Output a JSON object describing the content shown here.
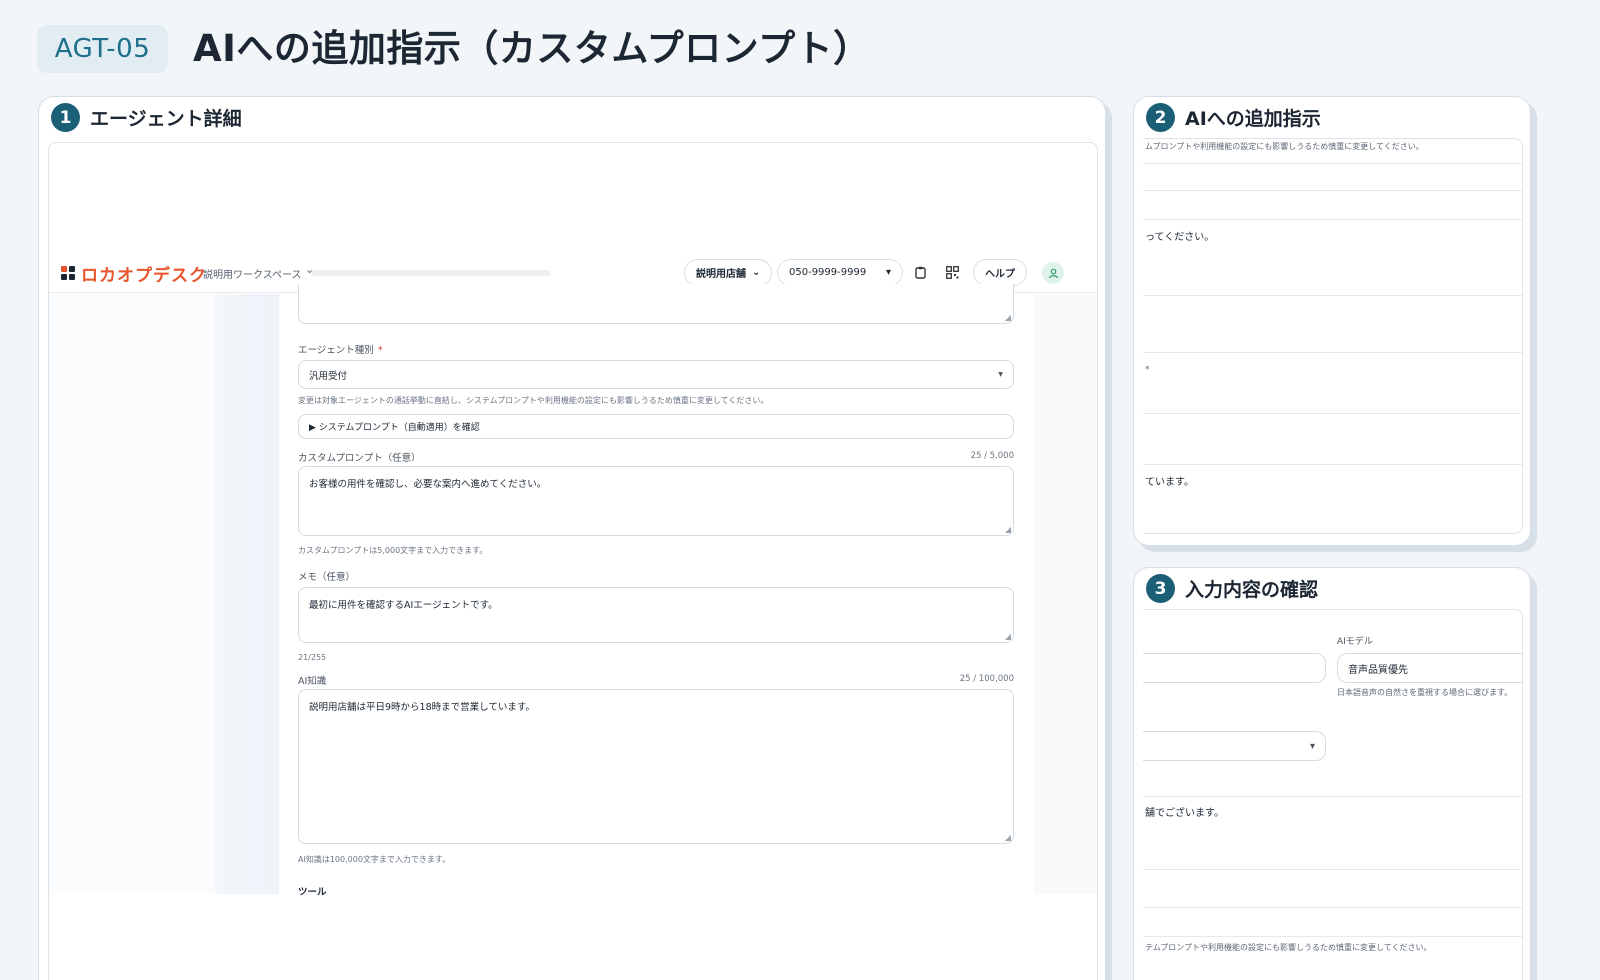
{
  "header": {
    "code": "AGT-05",
    "title": "AIへの追加指示（カスタムプロンプト）"
  },
  "panels": [
    {
      "number": "1",
      "title": "エージェント詳細"
    },
    {
      "number": "2",
      "title": "AIへの追加指示"
    },
    {
      "number": "3",
      "title": "入力内容の確認"
    }
  ],
  "app": {
    "logo_text": "ロカオプデスク",
    "workspace": "説明用ワークスペース",
    "store_select": "説明用店舗",
    "phone_select": "050-9999-9999",
    "help_label": "ヘルプ"
  },
  "form": {
    "agent_type_label": "エージェント種別",
    "required_mark": "*",
    "agent_type_value": "汎用受付",
    "agent_type_hint": "変更は対象エージェントの通話挙動に直結し、システムプロンプトや利用機能の設定にも影響しうるため慎重に変更してください。",
    "system_prompt_toggle": "▶ システムプロンプト（自動適用）を確認",
    "custom_prompt_label": "カスタムプロンプト（任意）",
    "custom_prompt_count": "25 / 5,000",
    "custom_prompt_value": "お客様の用件を確認し、必要な案内へ進めてください。",
    "custom_prompt_hint": "カスタムプロンプトは5,000文字まで入力できます。",
    "memo_label": "メモ（任意）",
    "memo_value": "最初に用件を確認するAIエージェントです。",
    "memo_count": "21/255",
    "knowledge_label": "AI知識",
    "knowledge_count": "25 / 100,000",
    "knowledge_value": "説明用店舗は平日9時から18時まで営業しています。",
    "knowledge_hint": "AI知識は100,000文字まで入力できます。",
    "tools_label": "ツール"
  },
  "panel2": {
    "hint_fragment": "ムプロンプトや利用機能の設定にも影響しうるため慎重に変更してください。",
    "prompt_fragment": "ってください。",
    "marker": "*",
    "knowledge_fragment": "ています。"
  },
  "panel3": {
    "model_label": "AIモデル",
    "model_value": "音声品質優先",
    "model_hint": "日本語音声の自然さを重視する場合に選びます。",
    "greeting_fragment": "舗でございます。",
    "hint_fragment": "テムプロンプトや利用機能の設定にも影響しうるため慎重に変更してください。"
  },
  "icons": {
    "logo": "logo-grid-icon",
    "chevron": "chevron-down-icon",
    "caret": "caret-down-icon",
    "clipboard": "clipboard-icon",
    "qr": "qr-code-icon",
    "user": "user-icon"
  },
  "colors": {
    "accent": "#1a5f76",
    "brand": "#e8542b",
    "required": "#e0364b"
  }
}
